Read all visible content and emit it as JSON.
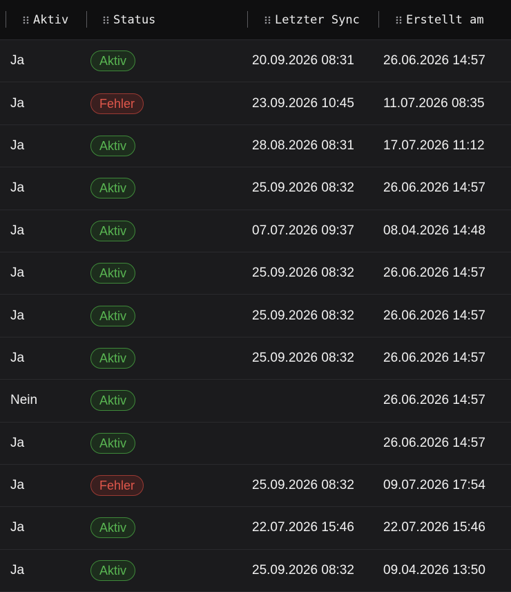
{
  "columns": {
    "aktiv": "Aktiv",
    "status": "Status",
    "letzter_sync": "Letzter Sync",
    "erstellt_am": "Erstellt am"
  },
  "status_colors": {
    "Aktiv": "#59b552",
    "Fehler": "#e0574b"
  },
  "rows": [
    {
      "aktiv": "Ja",
      "status": "Aktiv",
      "letzter_sync": "20.09.2026 08:31",
      "erstellt_am": "26.06.2026 14:57"
    },
    {
      "aktiv": "Ja",
      "status": "Fehler",
      "letzter_sync": "23.09.2026 10:45",
      "erstellt_am": "11.07.2026 08:35"
    },
    {
      "aktiv": "Ja",
      "status": "Aktiv",
      "letzter_sync": "28.08.2026 08:31",
      "erstellt_am": "17.07.2026 11:12"
    },
    {
      "aktiv": "Ja",
      "status": "Aktiv",
      "letzter_sync": "25.09.2026 08:32",
      "erstellt_am": "26.06.2026 14:57"
    },
    {
      "aktiv": "Ja",
      "status": "Aktiv",
      "letzter_sync": "07.07.2026 09:37",
      "erstellt_am": "08.04.2026 14:48"
    },
    {
      "aktiv": "Ja",
      "status": "Aktiv",
      "letzter_sync": "25.09.2026 08:32",
      "erstellt_am": "26.06.2026 14:57"
    },
    {
      "aktiv": "Ja",
      "status": "Aktiv",
      "letzter_sync": "25.09.2026 08:32",
      "erstellt_am": "26.06.2026 14:57"
    },
    {
      "aktiv": "Ja",
      "status": "Aktiv",
      "letzter_sync": "25.09.2026 08:32",
      "erstellt_am": "26.06.2026 14:57"
    },
    {
      "aktiv": "Nein",
      "status": "Aktiv",
      "letzter_sync": "",
      "erstellt_am": "26.06.2026 14:57"
    },
    {
      "aktiv": "Ja",
      "status": "Aktiv",
      "letzter_sync": "",
      "erstellt_am": "26.06.2026 14:57"
    },
    {
      "aktiv": "Ja",
      "status": "Fehler",
      "letzter_sync": "25.09.2026 08:32",
      "erstellt_am": "09.07.2026 17:54"
    },
    {
      "aktiv": "Ja",
      "status": "Aktiv",
      "letzter_sync": "22.07.2026 15:46",
      "erstellt_am": "22.07.2026 15:46"
    },
    {
      "aktiv": "Ja",
      "status": "Aktiv",
      "letzter_sync": "25.09.2026 08:32",
      "erstellt_am": "09.04.2026 13:50"
    }
  ]
}
